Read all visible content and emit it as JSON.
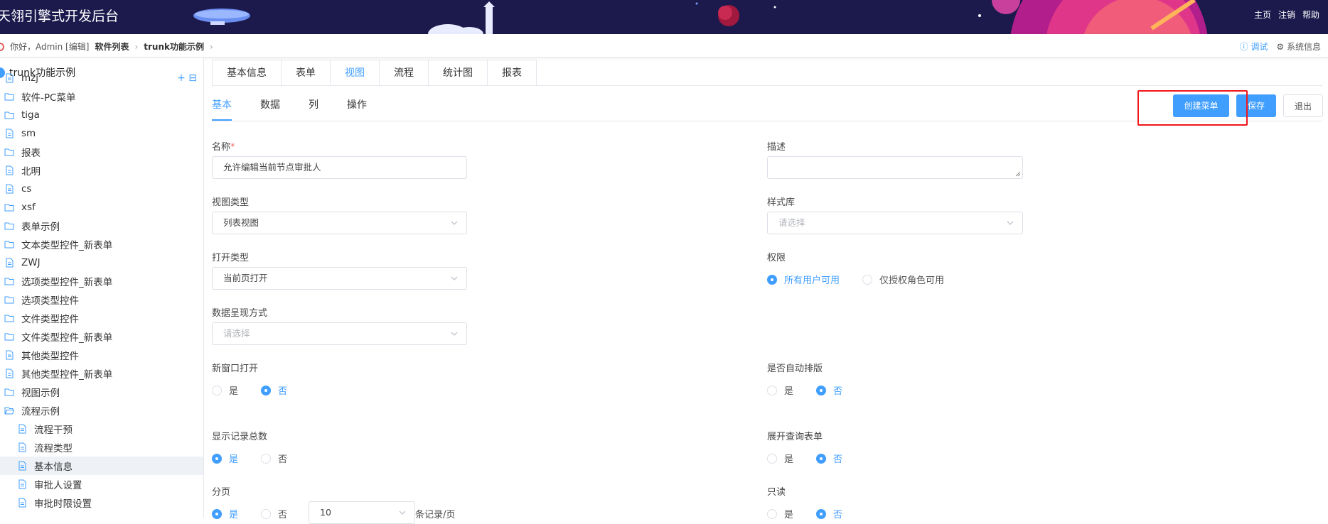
{
  "header": {
    "title": "天翎引擎式开发后台",
    "links": [
      "主页",
      "注销",
      "帮助"
    ]
  },
  "breadcrumb": {
    "greeting": "你好，Admin [编辑]",
    "items": [
      "软件列表",
      "trunk功能示例"
    ],
    "right": {
      "debug": "调试",
      "system_info": "系统信息"
    }
  },
  "sidebar": {
    "root": "trunk功能示例",
    "items": [
      {
        "label": "mzj",
        "icon": "file-icon",
        "level": 0
      },
      {
        "label": "软件-PC菜单",
        "icon": "folder-icon",
        "level": 0
      },
      {
        "label": "tiga",
        "icon": "folder-icon",
        "level": 0
      },
      {
        "label": "sm",
        "icon": "file-icon",
        "level": 0
      },
      {
        "label": "报表",
        "icon": "folder-icon",
        "level": 0
      },
      {
        "label": "北明",
        "icon": "file-icon",
        "level": 0
      },
      {
        "label": "cs",
        "icon": "file-icon",
        "level": 0
      },
      {
        "label": "xsf",
        "icon": "folder-icon",
        "level": 0
      },
      {
        "label": "表单示例",
        "icon": "folder-icon",
        "level": 0
      },
      {
        "label": "文本类型控件_新表单",
        "icon": "folder-icon",
        "level": 0
      },
      {
        "label": "ZWJ",
        "icon": "file-icon",
        "level": 0
      },
      {
        "label": "选项类型控件_新表单",
        "icon": "folder-icon",
        "level": 0
      },
      {
        "label": "选项类型控件",
        "icon": "folder-icon",
        "level": 0
      },
      {
        "label": "文件类型控件",
        "icon": "folder-icon",
        "level": 0
      },
      {
        "label": "文件类型控件_新表单",
        "icon": "folder-icon",
        "level": 0
      },
      {
        "label": "其他类型控件",
        "icon": "file-icon",
        "level": 0
      },
      {
        "label": "其他类型控件_新表单",
        "icon": "file-icon",
        "level": 0
      },
      {
        "label": "视图示例",
        "icon": "folder-icon",
        "level": 0
      },
      {
        "label": "流程示例",
        "icon": "folder-open-icon",
        "level": 0
      },
      {
        "label": "流程干预",
        "icon": "file-icon",
        "level": 1
      },
      {
        "label": "流程类型",
        "icon": "file-icon",
        "level": 1
      },
      {
        "label": "基本信息",
        "icon": "file-icon",
        "level": 1,
        "active": true
      },
      {
        "label": "审批人设置",
        "icon": "file-icon",
        "level": 1
      },
      {
        "label": "审批时限设置",
        "icon": "file-icon",
        "level": 1
      }
    ],
    "ops": "+ ⊟"
  },
  "tabs": [
    "基本信息",
    "表单",
    "视图",
    "流程",
    "统计图",
    "报表"
  ],
  "active_tab": "视图",
  "subtabs": [
    "基本",
    "数据",
    "列",
    "操作"
  ],
  "active_subtab": "基本",
  "buttons": {
    "create_menu": "创建菜单",
    "save": "保存",
    "exit": "退出"
  },
  "form": {
    "name": {
      "label": "名称",
      "required": "*",
      "value": "允许编辑当前节点审批人"
    },
    "description": {
      "label": "描述",
      "value": ""
    },
    "view_type": {
      "label": "视图类型",
      "value": "列表视图"
    },
    "style_lib": {
      "label": "样式库",
      "placeholder": "请选择"
    },
    "open_type": {
      "label": "打开类型",
      "value": "当前页打开"
    },
    "permission": {
      "label": "权限",
      "options": [
        "所有用户可用",
        "仅授权角色可用"
      ],
      "selected": 0
    },
    "display_mode": {
      "label": "数据呈现方式",
      "placeholder": "请选择"
    },
    "new_window": {
      "label": "新窗口打开",
      "options": [
        "是",
        "否"
      ],
      "selected": 1
    },
    "auto_layout": {
      "label": "是否自动排版",
      "options": [
        "是",
        "否"
      ],
      "selected": 1
    },
    "show_total": {
      "label": "显示记录总数",
      "options": [
        "是",
        "否"
      ],
      "selected": 0
    },
    "expand_query": {
      "label": "展开查询表单",
      "options": [
        "是",
        "否"
      ],
      "selected": 1
    },
    "paging": {
      "label": "分页",
      "options": [
        "是",
        "否"
      ],
      "selected": 0,
      "page_size": "10",
      "suffix": "条记录/页"
    },
    "readonly": {
      "label": "只读",
      "options": [
        "是",
        "否"
      ],
      "selected": 1
    }
  },
  "colors": {
    "accent": "#409eff",
    "header_bg": "#1c1a4d",
    "highlight": "#f0161a"
  }
}
